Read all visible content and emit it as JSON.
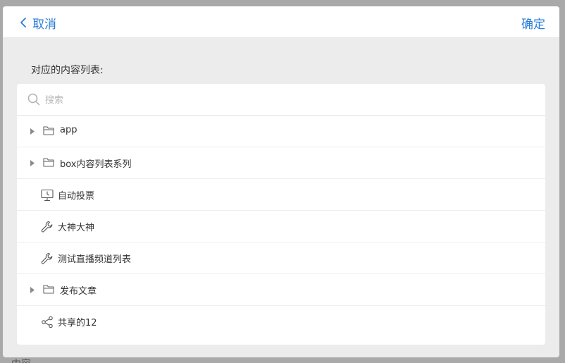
{
  "background": {
    "partial_text": "中容"
  },
  "header": {
    "cancel_label": "取消",
    "confirm_label": "确定",
    "accent_color": "#2a7dd8"
  },
  "section_label": "对应的内容列表:",
  "search": {
    "placeholder": "搜索",
    "value": ""
  },
  "items": [
    {
      "label": "app",
      "type": "folder",
      "icon": "folder-icon",
      "expandable": true
    },
    {
      "label": "box内容列表系列",
      "type": "folder",
      "icon": "folder-icon",
      "expandable": true
    },
    {
      "label": "自动投票",
      "type": "item",
      "icon": "monitor-icon",
      "expandable": false
    },
    {
      "label": "大神大神",
      "type": "item",
      "icon": "wrench-icon",
      "expandable": false
    },
    {
      "label": "测试直播频道列表",
      "type": "item",
      "icon": "wrench-icon",
      "expandable": false
    },
    {
      "label": "发布文章",
      "type": "folder",
      "icon": "folder-icon",
      "expandable": true
    },
    {
      "label": "共享的12",
      "type": "item",
      "icon": "share-icon",
      "expandable": false
    }
  ]
}
